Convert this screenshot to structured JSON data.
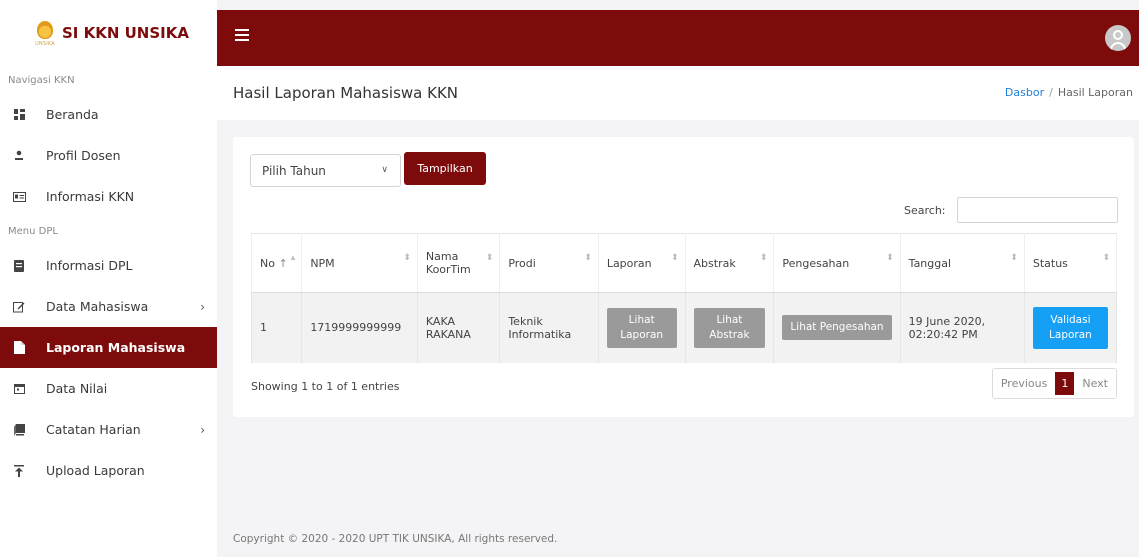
{
  "brand": {
    "title": "SI KKN UNSIKA",
    "logo_text": "UNSIKA"
  },
  "sidebar": {
    "sections": [
      {
        "heading": "Navigasi KKN"
      },
      {
        "heading": "Menu DPL"
      }
    ],
    "items": [
      {
        "label": "Beranda",
        "icon": "dashboard-icon"
      },
      {
        "label": "Profil Dosen",
        "icon": "user-icon"
      },
      {
        "label": "Informasi KKN",
        "icon": "id-card-icon"
      },
      {
        "label": "Informasi DPL",
        "icon": "file-icon"
      },
      {
        "label": "Data Mahasiswa",
        "icon": "edit-icon",
        "has_submenu": true
      },
      {
        "label": "Laporan Mahasiswa",
        "icon": "document-icon",
        "active": true
      },
      {
        "label": "Data Nilai",
        "icon": "calendar-icon"
      },
      {
        "label": "Catatan Harian",
        "icon": "book-icon",
        "has_submenu": true
      },
      {
        "label": "Upload Laporan",
        "icon": "upload-icon"
      }
    ],
    "chevron": "›"
  },
  "topbar": {
    "menu_icon": "hamburger-icon",
    "avatar_icon": "user-avatar-icon"
  },
  "page": {
    "title": "Hasil Laporan Mahasiswa KKN",
    "breadcrumb": {
      "home": "Dasbor",
      "separator": "/",
      "current": "Hasil Laporan"
    }
  },
  "filter": {
    "select_value": "Pilih Tahun",
    "button_label": "Tampilkan"
  },
  "search": {
    "label": "Search:",
    "value": ""
  },
  "table": {
    "columns": [
      "No",
      "NPM",
      "Nama KoorTim",
      "Prodi",
      "Laporan",
      "Abstrak",
      "Pengesahan",
      "Tanggal",
      "Status"
    ],
    "rows": [
      {
        "no": "1",
        "npm": "1719999999999",
        "nama": "KAKA RAKANA",
        "prodi": "Teknik Informatika",
        "laporan": "Lihat Laporan",
        "abstrak": "Lihat Abstrak",
        "pengesahan": "Lihat Pengesahan",
        "tanggal": "19 June 2020, 02:20:42 PM",
        "status": "Validasi Laporan"
      }
    ]
  },
  "pagination": {
    "info": "Showing 1 to 1 of 1 entries",
    "previous": "Previous",
    "current": "1",
    "next": "Next"
  },
  "footer": {
    "text": "Copyright © 2020 - 2020 UPT TIK UNSIKA, All rights reserved."
  },
  "colors": {
    "primary": "#7d0b0b",
    "info": "#16a0f5",
    "muted_button": "#9a9a9a"
  }
}
